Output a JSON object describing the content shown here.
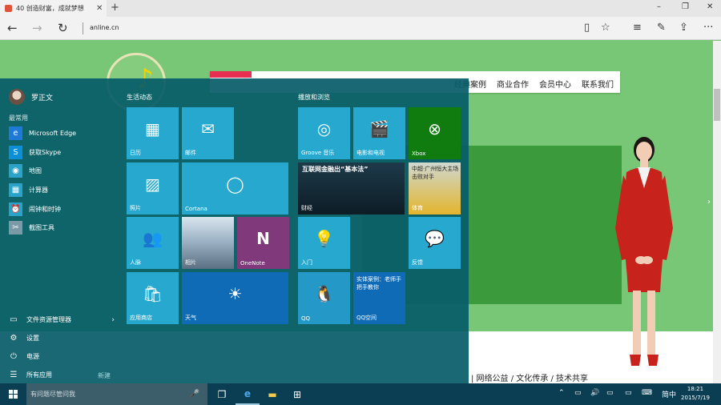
{
  "browser": {
    "tab_title": "40 创造财富，成就梦想",
    "new_tab": "+",
    "url": "anline.cn",
    "win_min": "–",
    "win_max": "❐",
    "win_close": "✕"
  },
  "site": {
    "nav": [
      "经典案例",
      "商业合作",
      "会员中心",
      "联系我们"
    ],
    "footer": "| 网络公益 / 文化传承 / 技术共享"
  },
  "start_menu": {
    "user_name": "罗正文",
    "most_used": "最常用",
    "apps": [
      {
        "icon": "edge-icon",
        "glyph": "e",
        "label": "Microsoft Edge",
        "color": "#1e7ad6"
      },
      {
        "icon": "skype-icon",
        "glyph": "S",
        "label": "获取Skype",
        "color": "#0c8fd6"
      },
      {
        "icon": "maps-icon",
        "glyph": "◉",
        "label": "地图",
        "color": "#2ba3c9"
      },
      {
        "icon": "calculator-icon",
        "glyph": "▦",
        "label": "计算器",
        "color": "#2ba3c9"
      },
      {
        "icon": "alarm-icon",
        "glyph": "⏰",
        "label": "闹钟和时钟",
        "color": "#2ba3c9"
      },
      {
        "icon": "paint-icon",
        "glyph": "✂",
        "label": "截图工具",
        "color": "#7a9aa8"
      }
    ],
    "bottom": [
      {
        "icon": "folder-icon",
        "glyph": "▭",
        "label": "文件资源管理器",
        "chevron": "›"
      },
      {
        "icon": "settings-icon",
        "glyph": "⚙",
        "label": "设置",
        "chevron": ""
      },
      {
        "icon": "power-icon",
        "glyph": "⏻",
        "label": "电源",
        "chevron": ""
      },
      {
        "icon": "all-apps-icon",
        "glyph": "☰",
        "label": "所有应用",
        "chevron": ""
      }
    ],
    "new_badge": "新建",
    "group1": "生活动态",
    "group2": "播放和浏览",
    "tiles": {
      "calendar": "日历",
      "mail": "邮件",
      "photos": "照片",
      "cortana": "Cortana",
      "contacts": "人脉",
      "photo_app": "相片",
      "onenote": "OneNote",
      "store": "应用商店",
      "weather": "天气",
      "groove": "Groove 音乐",
      "movies": "电影和电视",
      "xbox": "Xbox",
      "news_headline": "互联网金融出“基本法”",
      "news": "财经",
      "sports_headline": "中超·广州恒大主场击败对手",
      "sports": "体育",
      "tips": "入门",
      "feedback": "反馈",
      "qq": "QQ",
      "qq_case_text": "实体案例：老师手把手教你",
      "qq_case": "QQ空间"
    }
  },
  "taskbar": {
    "search_placeholder": "有问题尽管问我",
    "mic": "🎤",
    "tray_lang": "简中",
    "time": "18:21",
    "date": "2015/7/19"
  }
}
